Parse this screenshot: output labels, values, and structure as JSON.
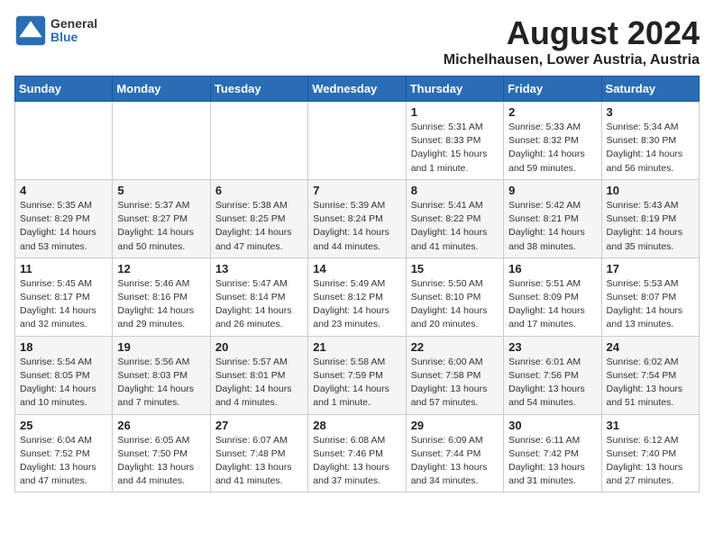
{
  "header": {
    "logo": {
      "line1": "General",
      "line2": "Blue"
    },
    "title": "August 2024",
    "subtitle": "Michelhausen, Lower Austria, Austria"
  },
  "weekdays": [
    "Sunday",
    "Monday",
    "Tuesday",
    "Wednesday",
    "Thursday",
    "Friday",
    "Saturday"
  ],
  "weeks": [
    [
      {
        "day": "",
        "info": ""
      },
      {
        "day": "",
        "info": ""
      },
      {
        "day": "",
        "info": ""
      },
      {
        "day": "",
        "info": ""
      },
      {
        "day": "1",
        "info": "Sunrise: 5:31 AM\nSunset: 8:33 PM\nDaylight: 15 hours\nand 1 minute."
      },
      {
        "day": "2",
        "info": "Sunrise: 5:33 AM\nSunset: 8:32 PM\nDaylight: 14 hours\nand 59 minutes."
      },
      {
        "day": "3",
        "info": "Sunrise: 5:34 AM\nSunset: 8:30 PM\nDaylight: 14 hours\nand 56 minutes."
      }
    ],
    [
      {
        "day": "4",
        "info": "Sunrise: 5:35 AM\nSunset: 8:29 PM\nDaylight: 14 hours\nand 53 minutes."
      },
      {
        "day": "5",
        "info": "Sunrise: 5:37 AM\nSunset: 8:27 PM\nDaylight: 14 hours\nand 50 minutes."
      },
      {
        "day": "6",
        "info": "Sunrise: 5:38 AM\nSunset: 8:25 PM\nDaylight: 14 hours\nand 47 minutes."
      },
      {
        "day": "7",
        "info": "Sunrise: 5:39 AM\nSunset: 8:24 PM\nDaylight: 14 hours\nand 44 minutes."
      },
      {
        "day": "8",
        "info": "Sunrise: 5:41 AM\nSunset: 8:22 PM\nDaylight: 14 hours\nand 41 minutes."
      },
      {
        "day": "9",
        "info": "Sunrise: 5:42 AM\nSunset: 8:21 PM\nDaylight: 14 hours\nand 38 minutes."
      },
      {
        "day": "10",
        "info": "Sunrise: 5:43 AM\nSunset: 8:19 PM\nDaylight: 14 hours\nand 35 minutes."
      }
    ],
    [
      {
        "day": "11",
        "info": "Sunrise: 5:45 AM\nSunset: 8:17 PM\nDaylight: 14 hours\nand 32 minutes."
      },
      {
        "day": "12",
        "info": "Sunrise: 5:46 AM\nSunset: 8:16 PM\nDaylight: 14 hours\nand 29 minutes."
      },
      {
        "day": "13",
        "info": "Sunrise: 5:47 AM\nSunset: 8:14 PM\nDaylight: 14 hours\nand 26 minutes."
      },
      {
        "day": "14",
        "info": "Sunrise: 5:49 AM\nSunset: 8:12 PM\nDaylight: 14 hours\nand 23 minutes."
      },
      {
        "day": "15",
        "info": "Sunrise: 5:50 AM\nSunset: 8:10 PM\nDaylight: 14 hours\nand 20 minutes."
      },
      {
        "day": "16",
        "info": "Sunrise: 5:51 AM\nSunset: 8:09 PM\nDaylight: 14 hours\nand 17 minutes."
      },
      {
        "day": "17",
        "info": "Sunrise: 5:53 AM\nSunset: 8:07 PM\nDaylight: 14 hours\nand 13 minutes."
      }
    ],
    [
      {
        "day": "18",
        "info": "Sunrise: 5:54 AM\nSunset: 8:05 PM\nDaylight: 14 hours\nand 10 minutes."
      },
      {
        "day": "19",
        "info": "Sunrise: 5:56 AM\nSunset: 8:03 PM\nDaylight: 14 hours\nand 7 minutes."
      },
      {
        "day": "20",
        "info": "Sunrise: 5:57 AM\nSunset: 8:01 PM\nDaylight: 14 hours\nand 4 minutes."
      },
      {
        "day": "21",
        "info": "Sunrise: 5:58 AM\nSunset: 7:59 PM\nDaylight: 14 hours\nand 1 minute."
      },
      {
        "day": "22",
        "info": "Sunrise: 6:00 AM\nSunset: 7:58 PM\nDaylight: 13 hours\nand 57 minutes."
      },
      {
        "day": "23",
        "info": "Sunrise: 6:01 AM\nSunset: 7:56 PM\nDaylight: 13 hours\nand 54 minutes."
      },
      {
        "day": "24",
        "info": "Sunrise: 6:02 AM\nSunset: 7:54 PM\nDaylight: 13 hours\nand 51 minutes."
      }
    ],
    [
      {
        "day": "25",
        "info": "Sunrise: 6:04 AM\nSunset: 7:52 PM\nDaylight: 13 hours\nand 47 minutes."
      },
      {
        "day": "26",
        "info": "Sunrise: 6:05 AM\nSunset: 7:50 PM\nDaylight: 13 hours\nand 44 minutes."
      },
      {
        "day": "27",
        "info": "Sunrise: 6:07 AM\nSunset: 7:48 PM\nDaylight: 13 hours\nand 41 minutes."
      },
      {
        "day": "28",
        "info": "Sunrise: 6:08 AM\nSunset: 7:46 PM\nDaylight: 13 hours\nand 37 minutes."
      },
      {
        "day": "29",
        "info": "Sunrise: 6:09 AM\nSunset: 7:44 PM\nDaylight: 13 hours\nand 34 minutes."
      },
      {
        "day": "30",
        "info": "Sunrise: 6:11 AM\nSunset: 7:42 PM\nDaylight: 13 hours\nand 31 minutes."
      },
      {
        "day": "31",
        "info": "Sunrise: 6:12 AM\nSunset: 7:40 PM\nDaylight: 13 hours\nand 27 minutes."
      }
    ]
  ]
}
